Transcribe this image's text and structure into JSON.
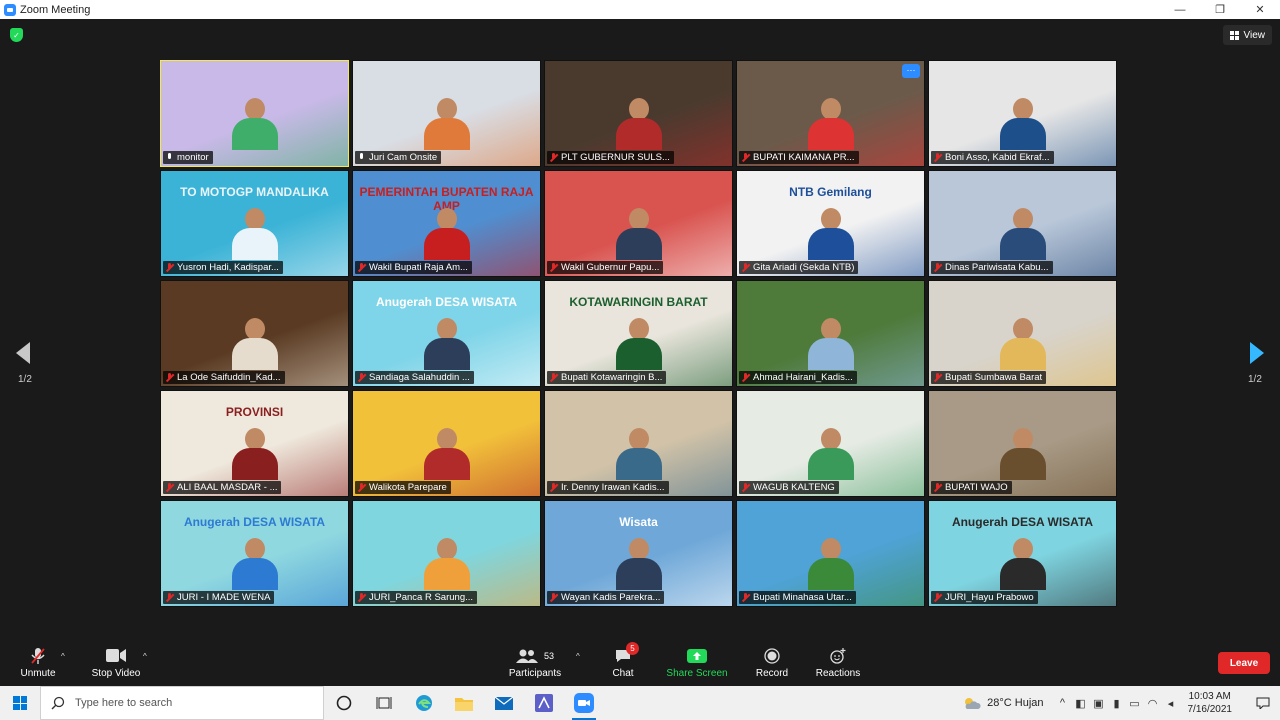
{
  "window": {
    "title": "Zoom Meeting",
    "minimize": "—",
    "maximize": "❐",
    "close": "✕"
  },
  "view_button": {
    "label": "View"
  },
  "pagination": {
    "left_label": "1/2",
    "right_label": "1/2"
  },
  "participants_grid": [
    {
      "name": "monitor",
      "muted": false,
      "active": true,
      "bg": "#c9b9e8",
      "accent": "#3fae6a",
      "banner": ""
    },
    {
      "name": "Juri Cam Onsite",
      "muted": false,
      "active": false,
      "bg": "#d9dde4",
      "accent": "#e07a3a",
      "banner": ""
    },
    {
      "name": "PLT GUBERNUR SULS...",
      "muted": true,
      "active": false,
      "bg": "#4a3a2e",
      "accent": "#b22b2b",
      "banner": ""
    },
    {
      "name": "BUPATI KAIMANA PR...",
      "muted": true,
      "active": false,
      "bg": "#6b5a4a",
      "accent": "#d33",
      "banner": ""
    },
    {
      "name": "Boni Asso, Kabid Ekraf...",
      "muted": true,
      "active": false,
      "bg": "#e6e6e6",
      "accent": "#1d4f8a",
      "banner": ""
    },
    {
      "name": "Yusron Hadi, Kadispar...",
      "muted": true,
      "active": false,
      "bg": "#3bb3d6",
      "accent": "#e8f4fa",
      "banner": "TO MOTOGP MANDALIKA"
    },
    {
      "name": "Wakil Bupati Raja Am...",
      "muted": true,
      "active": false,
      "bg": "#4f8fd1",
      "accent": "#c71f1f",
      "banner": "PEMERINTAH BUPATEN RAJA AMP"
    },
    {
      "name": "Wakil Gubernur Papu...",
      "muted": true,
      "active": false,
      "bg": "#d9534f",
      "accent": "#ffffff",
      "banner": ""
    },
    {
      "name": "Gita Ariadi (Sekda NTB)",
      "muted": true,
      "active": false,
      "bg": "#f2f2f2",
      "accent": "#1e4f9a",
      "banner": "NTB Gemilang"
    },
    {
      "name": "Dinas Pariwisata Kabu...",
      "muted": true,
      "active": false,
      "bg": "#b9c7d9",
      "accent": "#2a4c7a",
      "banner": ""
    },
    {
      "name": "La Ode Saifuddin_Kad...",
      "muted": true,
      "active": false,
      "bg": "#5a3a22",
      "accent": "#e6dccd",
      "banner": ""
    },
    {
      "name": "Sandiaga Salahuddin ...",
      "muted": true,
      "active": false,
      "bg": "#7ed4e8",
      "accent": "#ffffff",
      "banner": "Anugerah DESA WISATA"
    },
    {
      "name": "Bupati Kotawaringin B...",
      "muted": true,
      "active": false,
      "bg": "#e9e5dc",
      "accent": "#1c5f2e",
      "banner": "KOTAWARINGIN BARAT"
    },
    {
      "name": "Ahmad Hairani_Kadis...",
      "muted": true,
      "active": false,
      "bg": "#4e7a3a",
      "accent": "#8fb5d9",
      "banner": ""
    },
    {
      "name": "Bupati Sumbawa Barat",
      "muted": true,
      "active": false,
      "bg": "#d8d4cc",
      "accent": "#e3b85a",
      "banner": ""
    },
    {
      "name": "ALI BAAL MASDAR - ...",
      "muted": true,
      "active": false,
      "bg": "#efe8dc",
      "accent": "#8a1f1f",
      "banner": "PROVINSI"
    },
    {
      "name": "Walikota Parepare",
      "muted": true,
      "active": false,
      "bg": "#f2c13a",
      "accent": "#b22b2b",
      "banner": ""
    },
    {
      "name": "Ir. Denny Irawan Kadis...",
      "muted": true,
      "active": false,
      "bg": "#d2c3a8",
      "accent": "#3a6a8a",
      "banner": ""
    },
    {
      "name": "WAGUB KALTENG",
      "muted": true,
      "active": false,
      "bg": "#e6ebe4",
      "accent": "#3a9a5a",
      "banner": ""
    },
    {
      "name": "BUPATI WAJO",
      "muted": true,
      "active": false,
      "bg": "#a89a86",
      "accent": "#6a4f2e",
      "banner": ""
    },
    {
      "name": "JURI - I MADE WENA",
      "muted": true,
      "active": false,
      "bg": "#8fd8e0",
      "accent": "#2c7ad1",
      "banner": "Anugerah DESA WISATA"
    },
    {
      "name": "JURI_Panca R Sarung...",
      "muted": true,
      "active": false,
      "bg": "#7fd6de",
      "accent": "#f0a03a",
      "banner": ""
    },
    {
      "name": "Wayan Kadis Parekra...",
      "muted": true,
      "active": false,
      "bg": "#6fa8d8",
      "accent": "#ffffff",
      "banner": "Wisata"
    },
    {
      "name": "Bupati Minahasa Utar...",
      "muted": true,
      "active": false,
      "bg": "#4fa3d6",
      "accent": "#3a8a3a",
      "banner": ""
    },
    {
      "name": "JURI_Hayu Prabowo",
      "muted": true,
      "active": false,
      "bg": "#7ed4e0",
      "accent": "#2a2a2a",
      "banner": "Anugerah DESA WISATA"
    }
  ],
  "toolbar": {
    "unmute": "Unmute",
    "stop_video": "Stop Video",
    "participants": "Participants",
    "participants_count": "53",
    "chat": "Chat",
    "chat_badge": "5",
    "share_screen": "Share Screen",
    "record": "Record",
    "reactions": "Reactions",
    "leave": "Leave"
  },
  "taskbar": {
    "search_placeholder": "Type here to search",
    "weather": "28°C Hujan",
    "time": "10:03 AM",
    "date": "7/16/2021"
  },
  "colors": {
    "accent_blue": "#2d8cff",
    "share_green": "#23d959",
    "leave_red": "#e02828",
    "active_yellow": "#f6e94b"
  }
}
